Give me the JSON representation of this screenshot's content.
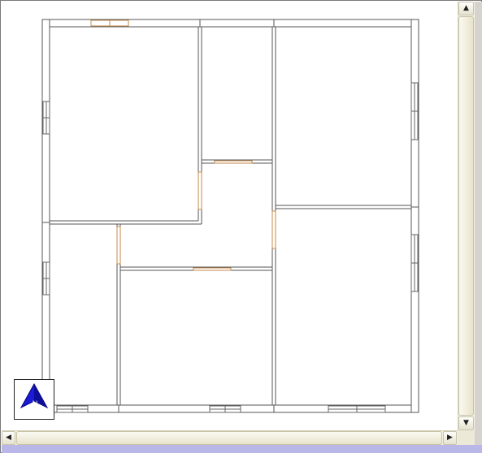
{
  "floorplan": {
    "wall_color": "#555555",
    "wall_fill": "#ffffff",
    "door_color": "#c48a4a",
    "window_color": "#666666"
  },
  "north_arrow": {
    "label": "N",
    "icon": "north-arrow-icon",
    "color": "#1b1bd6"
  },
  "scrollbars": {
    "vertical": {
      "up_icon": "up-arrow-icon",
      "down_icon": "down-arrow-icon",
      "up_glyph": "▲",
      "down_glyph": "▼"
    },
    "horizontal": {
      "left_icon": "left-arrow-icon",
      "right_icon": "right-arrow-icon",
      "left_glyph": "◀",
      "right_glyph": "▶"
    },
    "track_color": "#f3f1e2"
  }
}
